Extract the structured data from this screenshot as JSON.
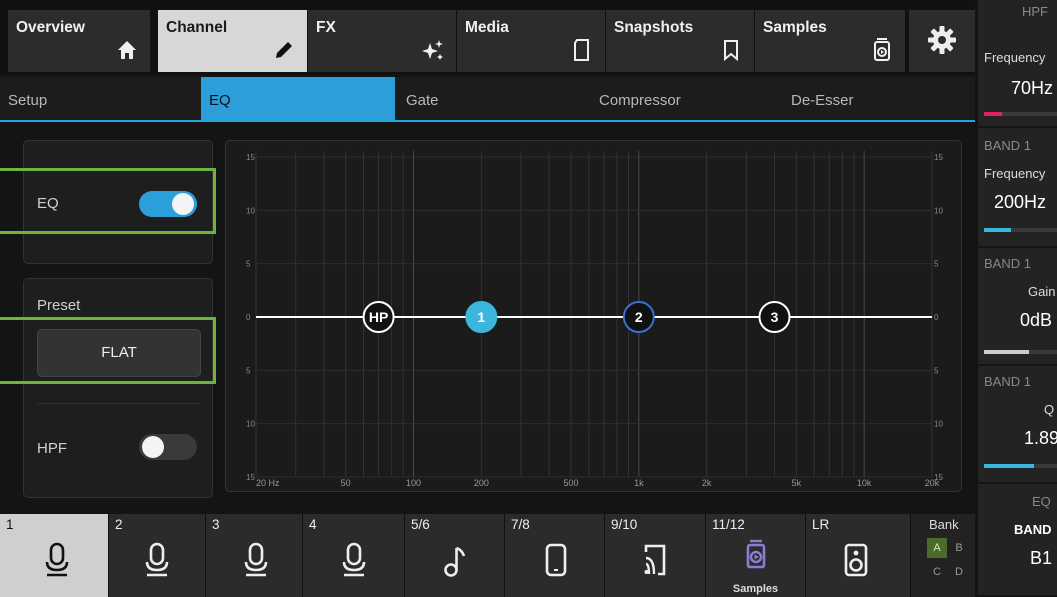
{
  "top_tabs": [
    {
      "label": "Overview",
      "icon": "home-icon"
    },
    {
      "label": "Channel",
      "icon": "pencil-icon",
      "active": true
    },
    {
      "label": "FX",
      "icon": "sparkle-icon"
    },
    {
      "label": "Media",
      "icon": "sd-card-icon"
    },
    {
      "label": "Snapshots",
      "icon": "bookmark-icon"
    },
    {
      "label": "Samples",
      "icon": "sampler-icon"
    }
  ],
  "settings_icon": "gear-icon",
  "sub_tabs": [
    {
      "label": "Setup"
    },
    {
      "label": "EQ",
      "active": true
    },
    {
      "label": "Gate"
    },
    {
      "label": "Compressor"
    },
    {
      "label": "De-Esser"
    }
  ],
  "left_panel": {
    "eq_label": "EQ",
    "eq_enabled": true,
    "preset_label": "Preset",
    "preset_value": "FLAT",
    "hpf_label": "HPF",
    "hpf_enabled": false
  },
  "eq_graph": {
    "y_ticks_left": [
      "15",
      "10",
      "5",
      "0",
      "5",
      "10",
      "15"
    ],
    "y_ticks_right": [
      "15",
      "10",
      "5",
      "0",
      "5",
      "10",
      "15"
    ],
    "x_ticks": [
      "20 Hz",
      "50",
      "100",
      "200",
      "500",
      "1k",
      "2k",
      "5k",
      "10k",
      "20k"
    ],
    "nodes": [
      {
        "label": "HP",
        "freq_hz": 70,
        "gain_db": 0,
        "style": "outline"
      },
      {
        "label": "1",
        "freq_hz": 200,
        "gain_db": 0,
        "style": "filled"
      },
      {
        "label": "2",
        "freq_hz": 1000,
        "gain_db": 0,
        "style": "ring"
      },
      {
        "label": "3",
        "freq_hz": 4000,
        "gain_db": 0,
        "style": "outline"
      }
    ],
    "colors": {
      "accent": "#2c9fdb",
      "filled_node": "#3bb6dc",
      "curve": "#ffffff"
    }
  },
  "channels": [
    {
      "label": "1",
      "icon": "microphone-icon",
      "active": true
    },
    {
      "label": "2",
      "icon": "microphone-icon"
    },
    {
      "label": "3",
      "icon": "microphone-icon"
    },
    {
      "label": "4",
      "icon": "microphone-icon"
    },
    {
      "label": "5/6",
      "icon": "music-note-icon"
    },
    {
      "label": "7/8",
      "icon": "phone-icon"
    },
    {
      "label": "9/10",
      "icon": "cast-icon"
    },
    {
      "label": "11/12",
      "icon": "sampler-icon",
      "sublabel": "Samples"
    },
    {
      "label": "LR",
      "icon": "speaker-icon"
    }
  ],
  "bank": {
    "title": "Bank",
    "options": [
      "A",
      "B",
      "C",
      "D"
    ],
    "selected": "A"
  },
  "right_column": [
    {
      "header": "HPF",
      "label": "Frequency",
      "value": "70Hz",
      "bar_level": 0.2,
      "bar_color": "#e0245e"
    },
    {
      "header": "BAND 1",
      "label": "Frequency",
      "value": "200Hz",
      "bar_level": 0.3,
      "bar_color": "#3bb6dc"
    },
    {
      "header": "BAND 1",
      "label": "Gain",
      "value": "0dB",
      "bar_level": 0.5,
      "bar_color": "#cccccc"
    },
    {
      "header": "BAND 1",
      "label": "Q",
      "value": "1.89",
      "bar_level": 0.55,
      "bar_color": "#3bb6dc"
    },
    {
      "header": "EQ",
      "label": "BAND",
      "value": "B1",
      "bar_level": null,
      "bar_color": ""
    }
  ]
}
